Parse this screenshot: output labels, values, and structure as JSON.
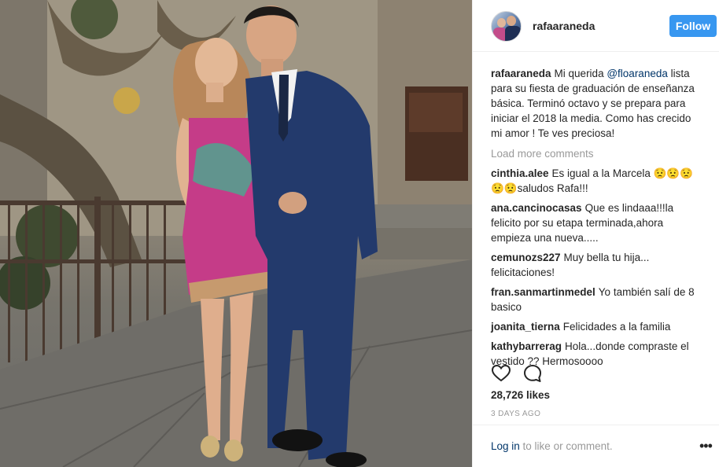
{
  "post": {
    "username": "rafaaraneda",
    "follow_label": "Follow",
    "caption": {
      "user": "rafaaraneda",
      "text_before": "Mi querida ",
      "mention": "@floaraneda",
      "text_after": " lista para su fiesta de graduación de enseñanza básica. Terminó octavo y se prepara para iniciar el 2018 la media. Como has crecido mi amor ! Te ves preciosa!"
    },
    "load_more_label": "Load more comments",
    "comments": [
      {
        "user": "cinthia.alee",
        "text": "Es igual a la Marcela 😟😟😟😟😟saludos Rafa!!!"
      },
      {
        "user": "ana.cancinocasas",
        "text": "Que es lindaaa!!!la felicito por su etapa terminada,ahora empieza una nueva....."
      },
      {
        "user": "cemunozs227",
        "text": "Muy bella tu hija... felicitaciones!"
      },
      {
        "user": "fran.sanmartinmedel",
        "text": "Yo también salí de 8 basico"
      },
      {
        "user": "joanita_tierna",
        "text": "Felicidades a la familia"
      },
      {
        "user": "kathybarrerag",
        "text": "Hola...donde compraste el vestido ?? Hermosoooo"
      }
    ],
    "likes_label": "28,726 likes",
    "timestamp": "3 DAYS AGO",
    "login_link": "Log in",
    "login_suffix": " to like or comment.",
    "more_options": "•••"
  },
  "icons": {
    "like": "heart-outline-icon",
    "comment": "speech-bubble-icon",
    "more": "ellipsis-icon"
  },
  "colors": {
    "follow_button": "#3897f0",
    "link": "#003569",
    "muted": "#999999"
  }
}
